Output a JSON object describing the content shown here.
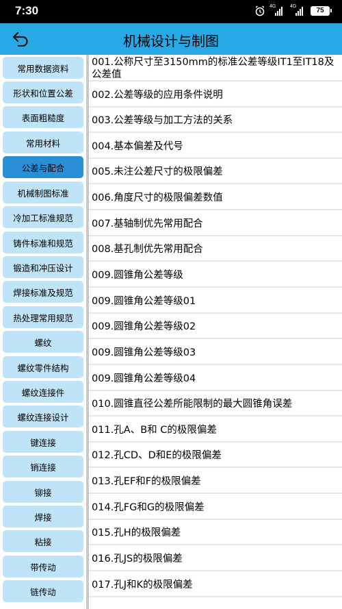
{
  "status_bar": {
    "time": "7:30",
    "net1": "4G",
    "net2": "4G",
    "battery": "75"
  },
  "header": {
    "title": "机械设计与制图",
    "back_icon": "back-arrow-icon"
  },
  "colors": {
    "header_bg": "#29a8e6",
    "sidebar_item_bg": "#bfe3f7",
    "sidebar_active_bg": "#2a8fd6"
  },
  "sidebar": {
    "items": [
      {
        "label": "常用数据资料",
        "active": false
      },
      {
        "label": "形状和位置公差",
        "active": false
      },
      {
        "label": "表面粗糙度",
        "active": false
      },
      {
        "label": "常用材料",
        "active": false
      },
      {
        "label": "公差与配合",
        "active": true
      },
      {
        "label": "机械制图标准",
        "active": false
      },
      {
        "label": "冷加工标准规范",
        "active": false
      },
      {
        "label": "铸件标准和规范",
        "active": false
      },
      {
        "label": "锻造和冲压设计",
        "active": false
      },
      {
        "label": "焊接标准及规范",
        "active": false
      },
      {
        "label": "热处理常用规范",
        "active": false
      },
      {
        "label": "螺纹",
        "active": false
      },
      {
        "label": "螺纹零件结构",
        "active": false
      },
      {
        "label": "螺纹连接件",
        "active": false
      },
      {
        "label": "螺纹连接设计",
        "active": false
      },
      {
        "label": "键连接",
        "active": false
      },
      {
        "label": "销连接",
        "active": false
      },
      {
        "label": "铆接",
        "active": false
      },
      {
        "label": "焊接",
        "active": false
      },
      {
        "label": "粘接",
        "active": false
      },
      {
        "label": "带传动",
        "active": false
      },
      {
        "label": "链传动",
        "active": false
      }
    ]
  },
  "content": {
    "items": [
      "001.公称尺寸至3150mm的标准公差等级IT1至IT18及公差值",
      "002.公差等级的应用条件说明",
      "003.公差等级与加工方法的关系",
      "004.基本偏差及代号",
      "005.未注公差尺寸的极限偏差",
      "006.角度尺寸的极限偏差数值",
      "007.基轴制优先常用配合",
      "008.基孔制优先常用配合",
      "009.圆锥角公差等级",
      "009.圆锥角公差等级01",
      "009.圆锥角公差等级02",
      "009.圆锥角公差等级03",
      "009.圆锥角公差等级04",
      "010.圆锥直径公差所能限制的最大圆锥角误差",
      "011.孔A、B和 C的极限偏差",
      "012.孔CD、D和E的极限偏差",
      "013.孔EF和F的极限偏差",
      "014.孔FG和G的极限偏差",
      "015.孔H的极限偏差",
      "016.孔JS的极限偏差",
      "017.孔J和K的极限偏差"
    ]
  }
}
